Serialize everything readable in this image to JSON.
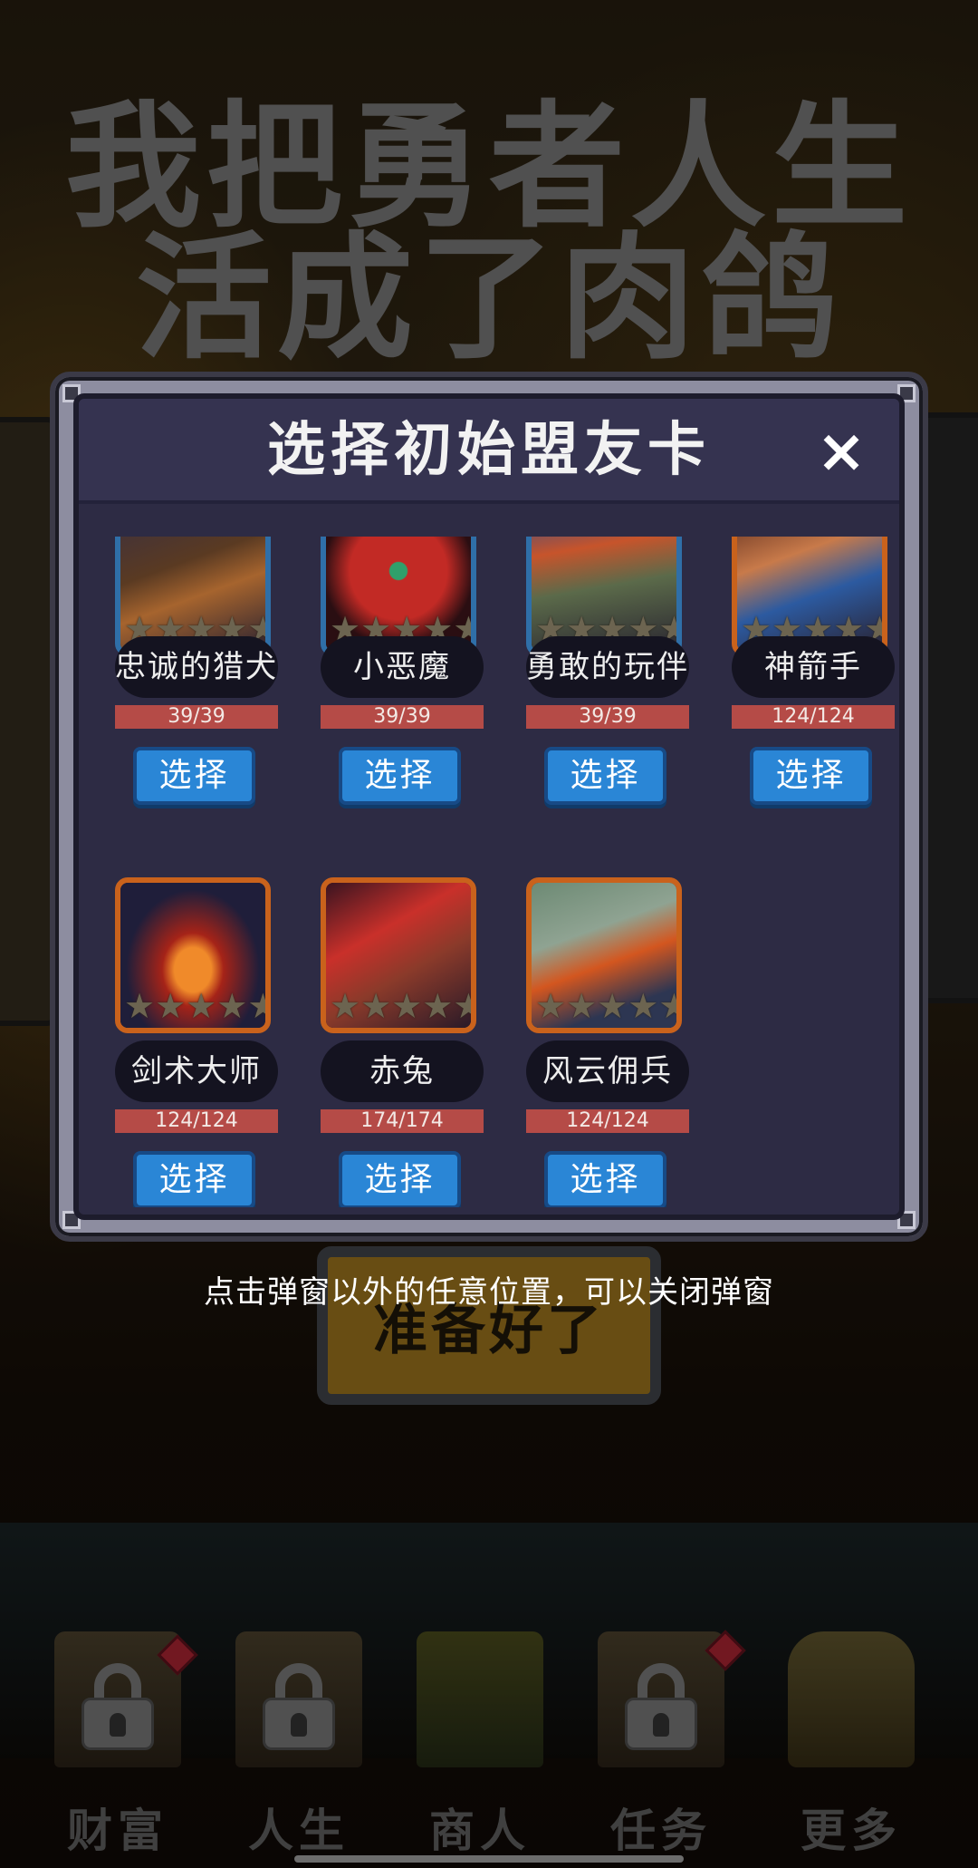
{
  "background": {
    "title_lines": [
      "我把勇者人生",
      "活成了肉鸽"
    ],
    "ready_button": "准备好了"
  },
  "dialog": {
    "title": "选择初始盟友卡",
    "close_label": "×",
    "select_label": "选择",
    "cards": [
      {
        "name": "忠诚的猎犬",
        "hp": "39/39"
      },
      {
        "name": "小恶魔",
        "hp": "39/39"
      },
      {
        "name": "勇敢的玩伴",
        "hp": "39/39"
      },
      {
        "name": "神箭手",
        "hp": "124/124"
      },
      {
        "name": "剑术大师",
        "hp": "124/124"
      },
      {
        "name": "赤兔",
        "hp": "174/174"
      },
      {
        "name": "风云佣兵",
        "hp": "124/124"
      }
    ],
    "star_glyph": "★",
    "colors": {
      "accent": "#2a86d6",
      "hp": "#b54b47",
      "frame_orange": "#c9621c",
      "frame_blue": "#2f6fa8"
    }
  },
  "hint": "点击弹窗以外的任意位置，可以关闭弹窗",
  "nav": {
    "items": [
      {
        "label": "财富",
        "icon": "lock-icon",
        "badge": true
      },
      {
        "label": "人生",
        "icon": "lock-icon",
        "badge": false
      },
      {
        "label": "商人",
        "icon": "tent-icon",
        "badge": false
      },
      {
        "label": "任务",
        "icon": "lock-icon",
        "badge": true
      },
      {
        "label": "更多",
        "icon": "pot-icon",
        "badge": false
      }
    ]
  }
}
